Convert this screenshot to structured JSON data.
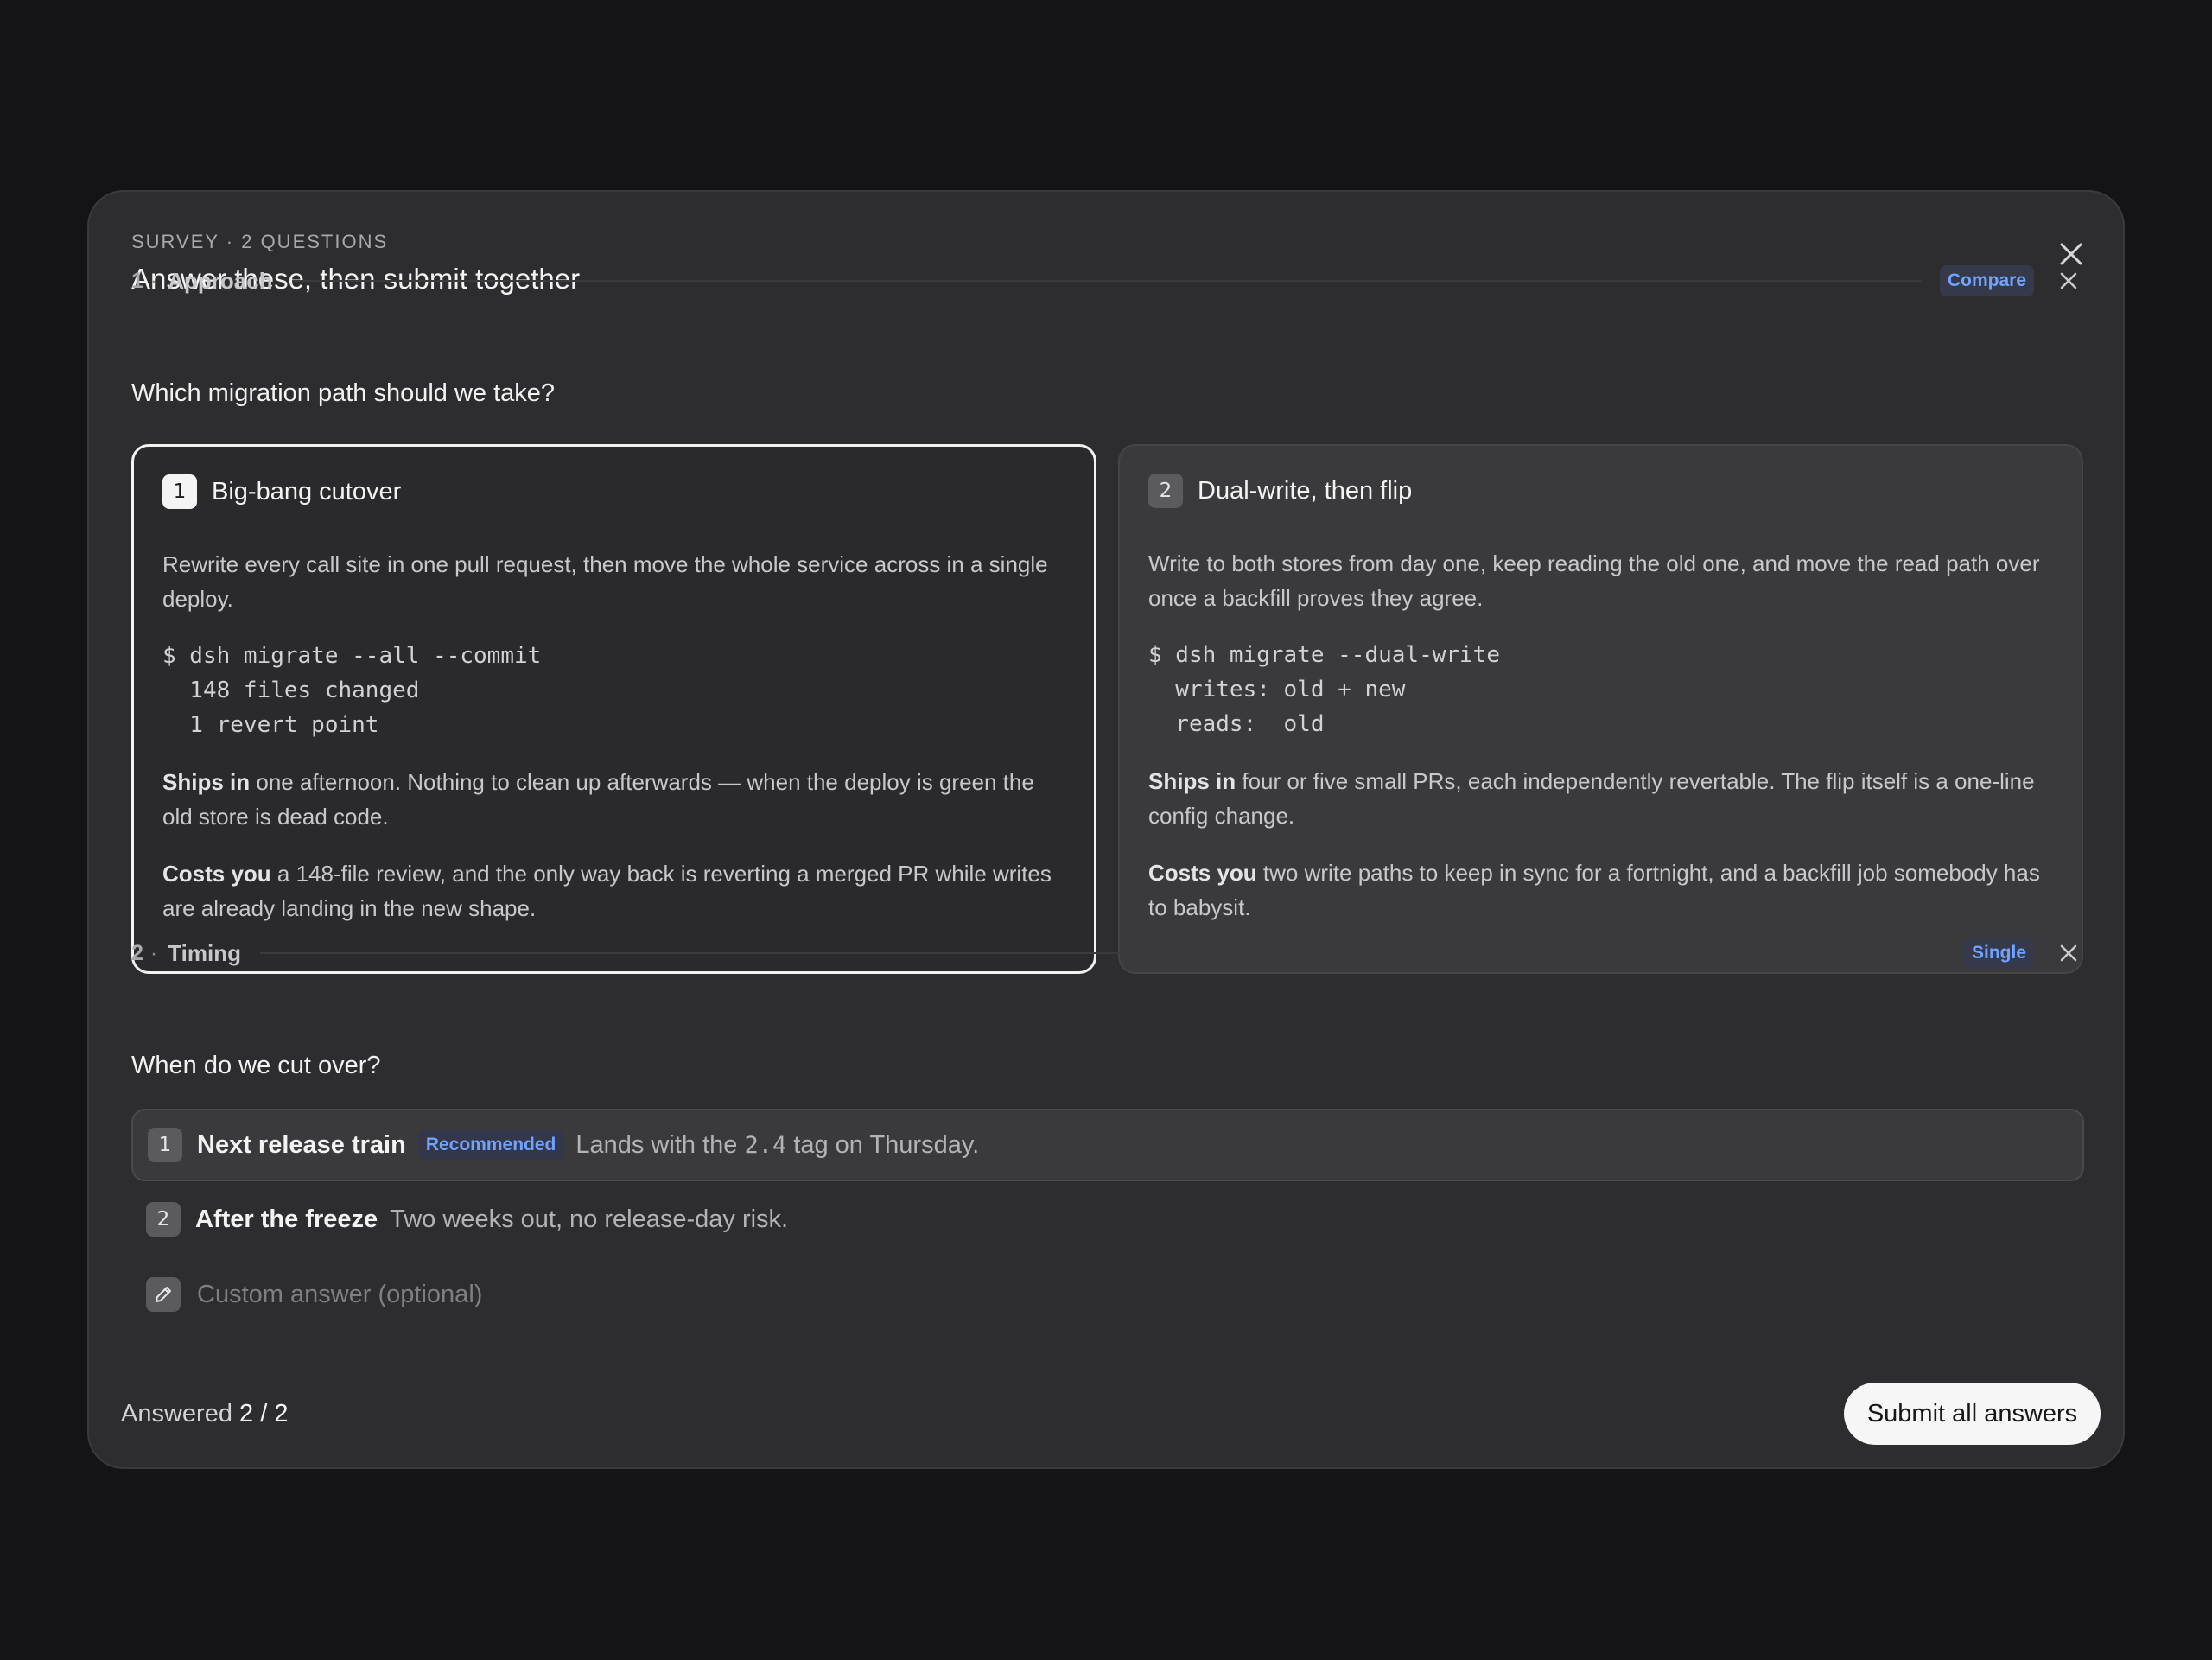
{
  "header": {
    "eyebrow": "SURVEY · 2 QUESTIONS",
    "title": "Answer these, then submit together",
    "close_icon": "close-icon"
  },
  "questions": [
    {
      "number": "1",
      "separator": "·",
      "section": "Approach",
      "mode_badge": "Compare",
      "prompt": "Which migration path should we take?",
      "options": [
        {
          "number": "1",
          "title": "Big-bang cutover",
          "selected": true,
          "description": "Rewrite every call site in one pull request, then move the whole service across in a single deploy.",
          "code": "$ dsh migrate --all --commit\n  148 files changed\n  1 revert point",
          "ships_label": "Ships in",
          "ships_text": "one afternoon. Nothing to clean up afterwards — when the deploy is green the old store is dead code.",
          "costs_label": "Costs you",
          "costs_text": "a 148-file review, and the only way back is reverting a merged PR while writes are already landing in the new shape."
        },
        {
          "number": "2",
          "title": "Dual-write, then flip",
          "selected": false,
          "description": "Write to both stores from day one, keep reading the old one, and move the read path over once a backfill proves they agree.",
          "code": "$ dsh migrate --dual-write\n  writes: old + new\n  reads:  old",
          "ships_label": "Ships in",
          "ships_text": "four or five small PRs, each independently revertable. The flip itself is a one-line config change.",
          "costs_label": "Costs you",
          "costs_text": "two write paths to keep in sync for a fortnight, and a backfill job somebody has to babysit."
        }
      ]
    },
    {
      "number": "2",
      "separator": "·",
      "section": "Timing",
      "mode_badge": "Single",
      "prompt": "When do we cut over?",
      "options": [
        {
          "number": "1",
          "label": "Next release train",
          "badge": "Recommended",
          "desc_before": "Lands with the",
          "desc_code": "2.4",
          "desc_after": "tag on Thursday.",
          "selected": true
        },
        {
          "number": "2",
          "label": "After the freeze",
          "description": "Two weeks out, no release-day risk.",
          "selected": false
        }
      ],
      "custom": {
        "icon": "pencil-icon",
        "placeholder": "Custom answer (optional)",
        "value": ""
      }
    }
  ],
  "footer": {
    "answered_label": "Answered",
    "answered_count": "2 / 2",
    "submit_label": "Submit all answers"
  },
  "colors": {
    "accent": "#6fa3ff",
    "background": "#141416",
    "panel": "#2d2d2f"
  }
}
